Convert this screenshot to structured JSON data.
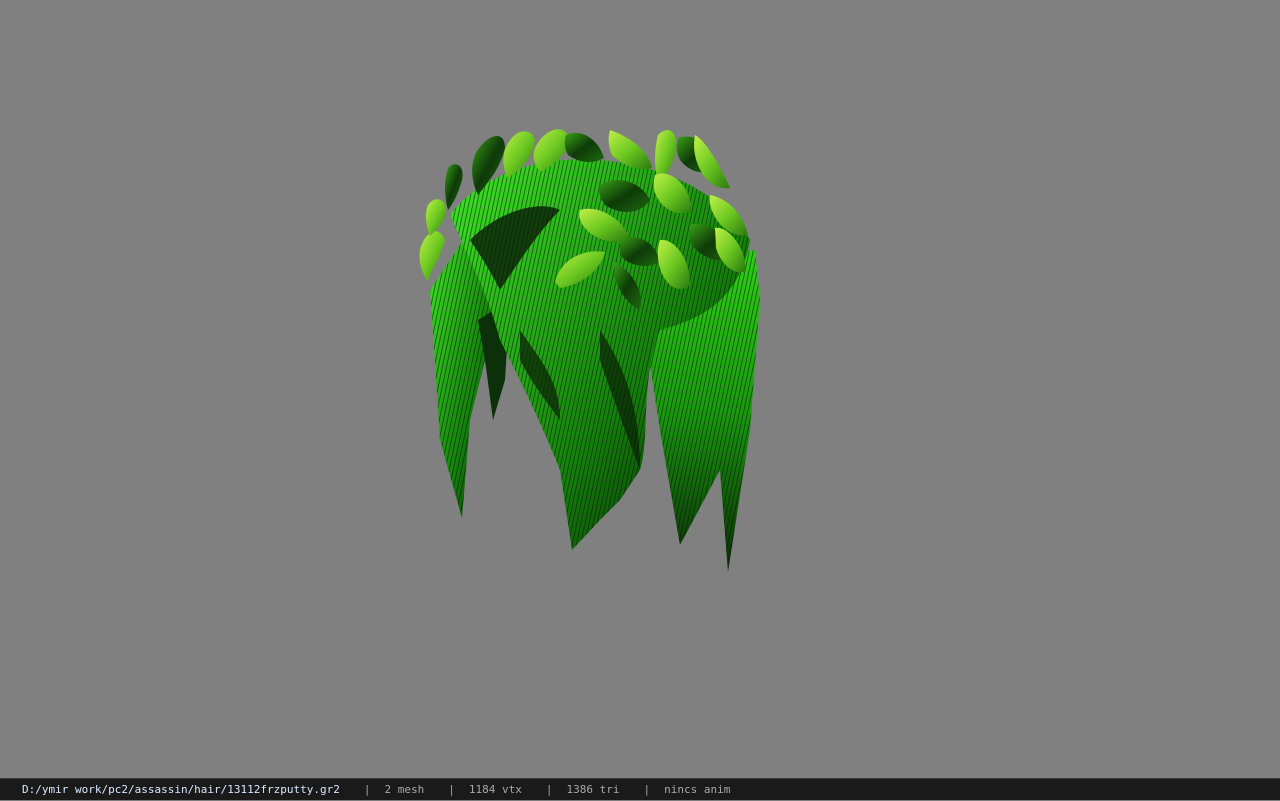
{
  "viewport": {
    "background": "#808080",
    "model_colors": {
      "hair_dark": "#0a1a08",
      "hair_mid": "#1a8a12",
      "hair_bright": "#38e020",
      "leaf_light": "#a8e838",
      "leaf_mid": "#58c018",
      "leaf_dark": "#123a0c"
    }
  },
  "status_bar": {
    "file_path": "D:/ymir work/pc2/assassin/hair/13112frzputty.gr2",
    "separator": "|",
    "mesh_count": "2 mesh",
    "vertex_count": "1184 vtx",
    "triangle_count": "1386 tri",
    "animation": "nincs anim"
  }
}
